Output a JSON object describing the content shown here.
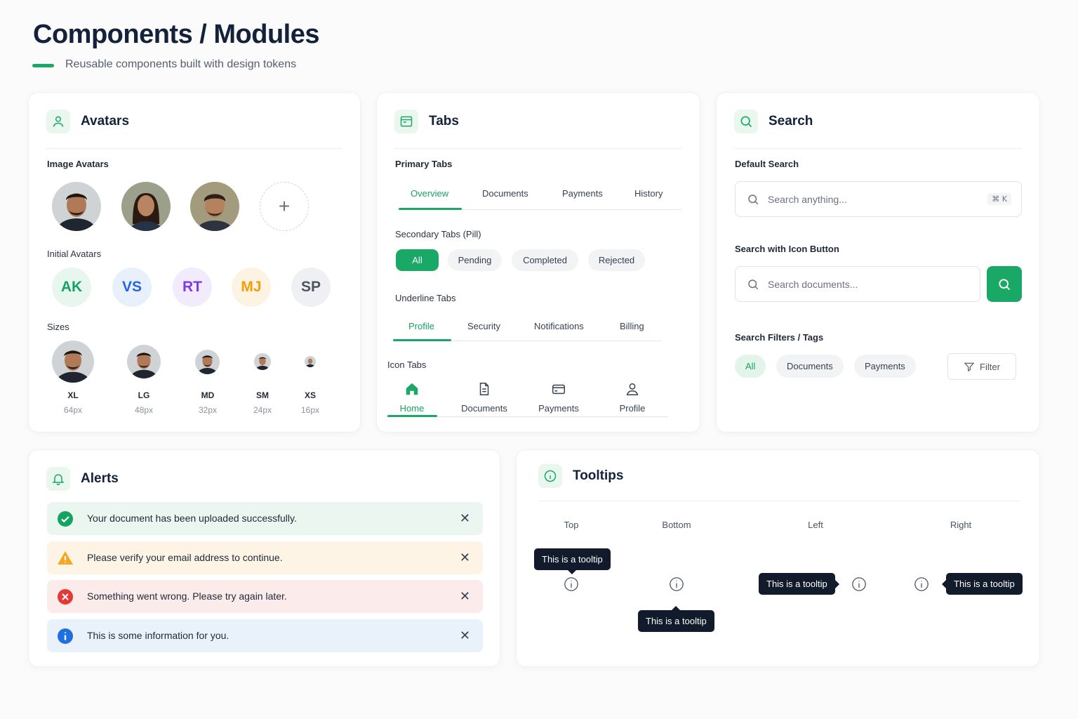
{
  "header": {
    "title": "Components / Modules",
    "subtitle": "Reusable components built with design tokens"
  },
  "avatars": {
    "title": "Avatars",
    "image_label": "Image Avatars",
    "add_symbol": "+",
    "initial_label": "Initial Avatars",
    "initials": [
      {
        "text": "AK",
        "color": "#16a362",
        "bg": "#e7f6ee"
      },
      {
        "text": "VS",
        "color": "#2563eb",
        "bg": "#e8f0fc"
      },
      {
        "text": "RT",
        "color": "#7c3aed",
        "bg": "#f1ebfc"
      },
      {
        "text": "MJ",
        "color": "#f59e0b",
        "bg": "#fdf3e2"
      },
      {
        "text": "SP",
        "color": "#4b5563",
        "bg": "#eef0f3"
      }
    ],
    "sizes_label": "Sizes",
    "sizes": [
      {
        "name": "XL",
        "px": "64px"
      },
      {
        "name": "LG",
        "px": "48px"
      },
      {
        "name": "MD",
        "px": "32px"
      },
      {
        "name": "SM",
        "px": "24px"
      },
      {
        "name": "XS",
        "px": "16px"
      }
    ]
  },
  "tabs": {
    "title": "Tabs",
    "primary_label": "Primary Tabs",
    "primary": [
      "Overview",
      "Documents",
      "Payments",
      "History"
    ],
    "secondary_label": "Secondary Tabs (Pill)",
    "secondary": [
      "All",
      "Pending",
      "Completed",
      "Rejected"
    ],
    "underline_label": "Underline Tabs",
    "underline": [
      "Profile",
      "Security",
      "Notifications",
      "Billing"
    ],
    "icon_label": "Icon Tabs",
    "icon_tabs": [
      {
        "label": "Home",
        "icon": "home-icon"
      },
      {
        "label": "Documents",
        "icon": "document-icon"
      },
      {
        "label": "Payments",
        "icon": "credit-card-icon"
      },
      {
        "label": "Profile",
        "icon": "user-icon"
      }
    ]
  },
  "search": {
    "title": "Search",
    "default_label": "Default Search",
    "default_placeholder": "Search anything...",
    "shortcut": "⌘ K",
    "icon_button_label": "Search with Icon Button",
    "icon_button_placeholder": "Search documents...",
    "filters_label": "Search Filters / Tags",
    "tags": [
      "All",
      "Documents",
      "Payments"
    ],
    "filter_button": "Filter"
  },
  "alerts": {
    "title": "Alerts",
    "items": [
      {
        "type": "success",
        "message": "Your document has been uploaded successfully.",
        "bg": "#eaf6ef",
        "color": "#16a362"
      },
      {
        "type": "warning",
        "message": "Please verify your email address to continue.",
        "bg": "#fdf4e6",
        "color": "#f5a623"
      },
      {
        "type": "error",
        "message": "Something went wrong. Please try again later.",
        "bg": "#fcebeb",
        "color": "#e53935"
      },
      {
        "type": "info",
        "message": "This is some information for you.",
        "bg": "#e9f1fb",
        "color": "#1e6fe0"
      }
    ],
    "close_symbol": "✕"
  },
  "tooltips": {
    "title": "Tooltips",
    "positions": [
      "Top",
      "Bottom",
      "Left",
      "Right"
    ],
    "tooltip_text": "This is a tooltip"
  },
  "colors": {
    "accent": "#1aa866",
    "dark": "#111b2b"
  }
}
